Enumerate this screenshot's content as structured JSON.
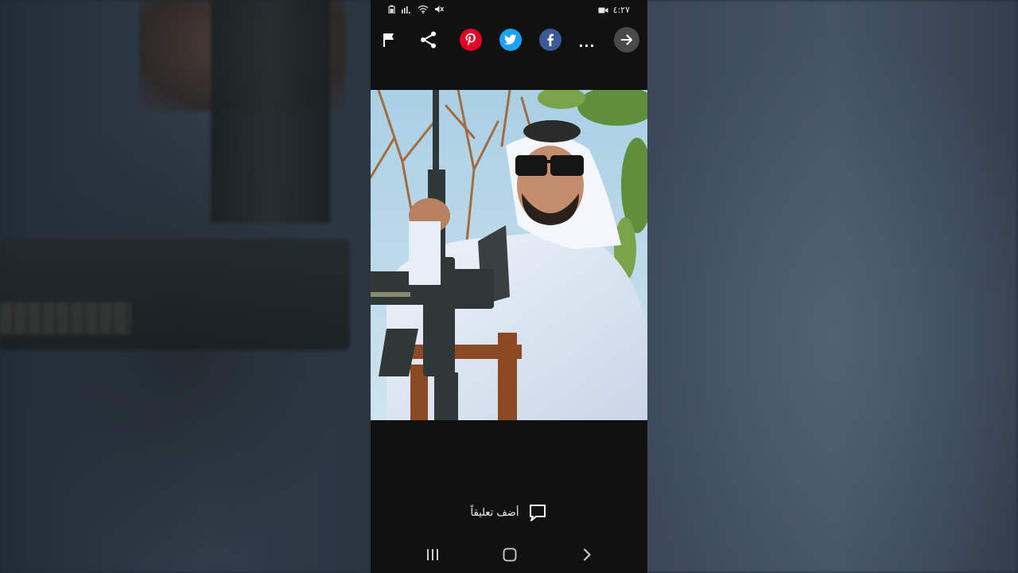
{
  "status_bar": {
    "time": "٤:٢٧"
  },
  "toolbar": {
    "icons": [
      "flag-icon",
      "share-icon",
      "pinterest-icon",
      "twitter-icon",
      "facebook-icon",
      "more-icon",
      "arrow-right-icon"
    ],
    "more_label": "...",
    "colors": {
      "pinterest": "#e60023",
      "twitter": "#1da1f2",
      "facebook": "#3b5998",
      "arrow_bg": "#4a4a4a"
    }
  },
  "comment": {
    "label": "أضف تعليقاً"
  },
  "nav": {
    "icons": [
      "recents-icon",
      "home-icon",
      "back-icon"
    ]
  }
}
